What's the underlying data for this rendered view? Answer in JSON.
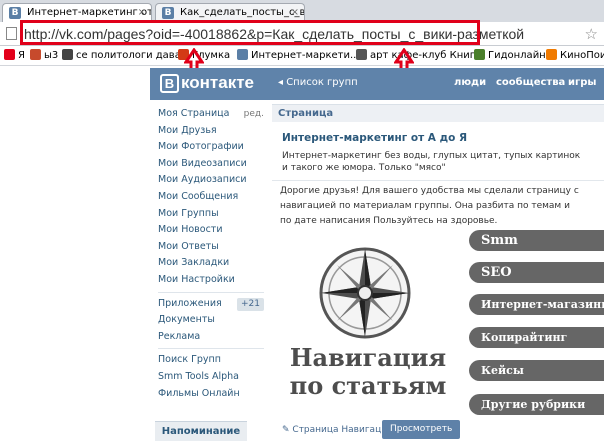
{
  "browser": {
    "tabs": [
      {
        "favicon": "B",
        "label": "Интернет-маркетинг от A",
        "active": true
      },
      {
        "favicon": "B",
        "label": "Как_сделать_посты_с_ви",
        "active": false
      }
    ],
    "url": "http://vk.com/pages?oid=-40018862&p=Как_сделать_посты_с_вики-разметкой",
    "bookmarks": [
      {
        "label": "Я",
        "icon_color": "#e3001b"
      },
      {
        "label": "ы3",
        "icon_color": "#c74a2c"
      },
      {
        "label": "се политологи дава...",
        "icon_color": "#444444"
      },
      {
        "label": "Глумка",
        "icon_color": "#d33a16"
      },
      {
        "label": "Интернет-маркети...",
        "icon_color": "#5b7fa6"
      },
      {
        "label": "арт кафе-клуб Книг...",
        "icon_color": "#555555"
      },
      {
        "label": "Гидонлайн",
        "icon_color": "#4a7f2a"
      },
      {
        "label": "КиноПоис",
        "icon_color": "#f07a00"
      }
    ]
  },
  "vk": {
    "logo_letter": "B",
    "logo_text": "контакте",
    "group_list_link": "◂ Список групп",
    "nav": [
      "люди",
      "сообщества",
      "игры"
    ]
  },
  "left_menu": {
    "main": [
      {
        "label": "Моя Страница",
        "extra": "ред."
      },
      {
        "label": "Мои Друзья"
      },
      {
        "label": "Мои Фотографии"
      },
      {
        "label": "Мои Видеозаписи"
      },
      {
        "label": "Мои Аудиозаписи"
      },
      {
        "label": "Мои Сообщения"
      },
      {
        "label": "Мои Группы"
      },
      {
        "label": "Мои Новости"
      },
      {
        "label": "Мои Ответы"
      },
      {
        "label": "Мои Закладки"
      },
      {
        "label": "Мои Настройки"
      }
    ],
    "apps": [
      {
        "label": "Приложения",
        "badge": "+21"
      },
      {
        "label": "Документы"
      },
      {
        "label": "Реклама"
      }
    ],
    "extra": [
      {
        "label": "Поиск Групп"
      },
      {
        "label": "Smm Tools Alpha"
      },
      {
        "label": "Фильмы Онлайн"
      }
    ],
    "reminder": "Напоминание"
  },
  "content": {
    "breadcrumb": "Страница",
    "group_title": "Интернет-маркетинг от А до Я",
    "group_desc": "Интернет-маркетинг без воды, глупых цитат, тупых картинок и такого же юмора. Только \"мясо\"",
    "intro": "Дорогие друзья! Для вашего удобства мы сделали страницу с навигацией по материалам группы. Она разбита по темам и по дате написания Пользуйтесь на здоровье.",
    "nav_line1": "Навигация",
    "nav_line2": "по статьям",
    "rubrics": [
      "Smm",
      "SEO",
      "Интернет-магазины",
      "Копирайтинг",
      "Кейсы",
      "Другие рубрики"
    ],
    "page_nav_label": "Страница Навигация",
    "preview_button": "Просмотреть"
  },
  "colors": {
    "vk_blue": "#5f83aa",
    "highlight_red": "#e0001a",
    "pill_gray": "#666666"
  }
}
